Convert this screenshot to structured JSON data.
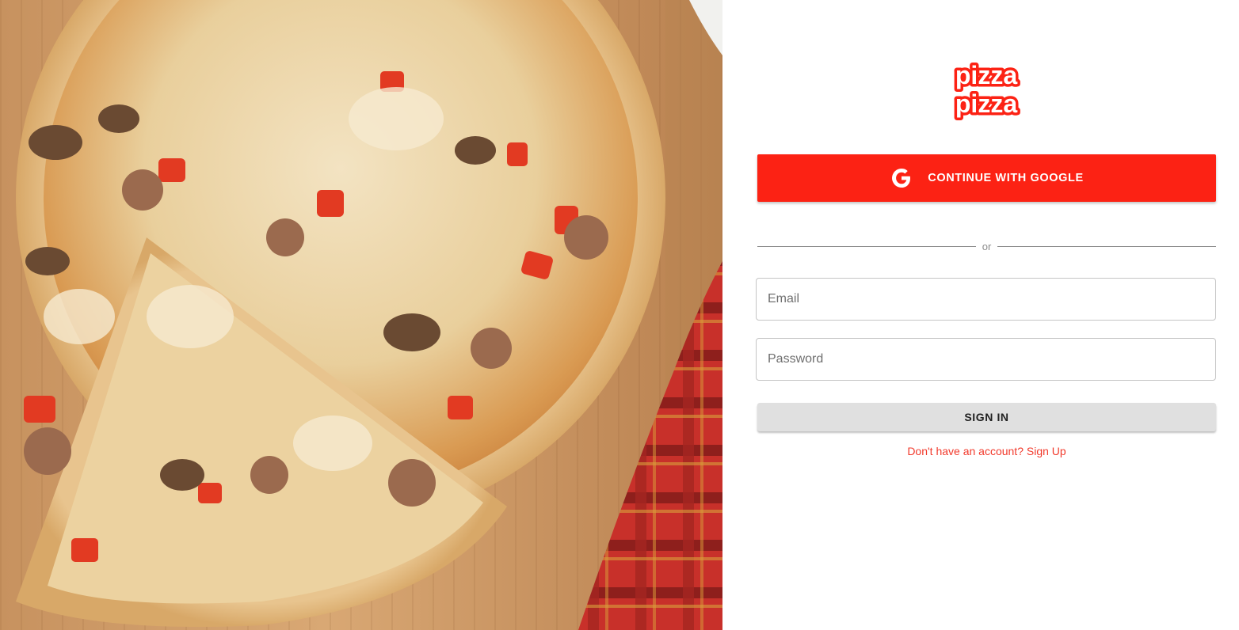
{
  "hero": {
    "image_icon": "pizza-photo"
  },
  "logo": {
    "line1": "pizza",
    "line2": "pizza",
    "color": "#fc2214"
  },
  "auth": {
    "google_button_label": "CONTINUE WITH GOOGLE",
    "google_icon": "google-g-icon",
    "divider_text": "or",
    "email_placeholder": "Email",
    "password_placeholder": "Password",
    "signin_label": "SIGN IN",
    "signup_link": "Don't have an account? Sign Up"
  },
  "colors": {
    "brand_red": "#fc2214",
    "link_red": "#f23a2c",
    "signin_bg": "#e0e0e0"
  }
}
